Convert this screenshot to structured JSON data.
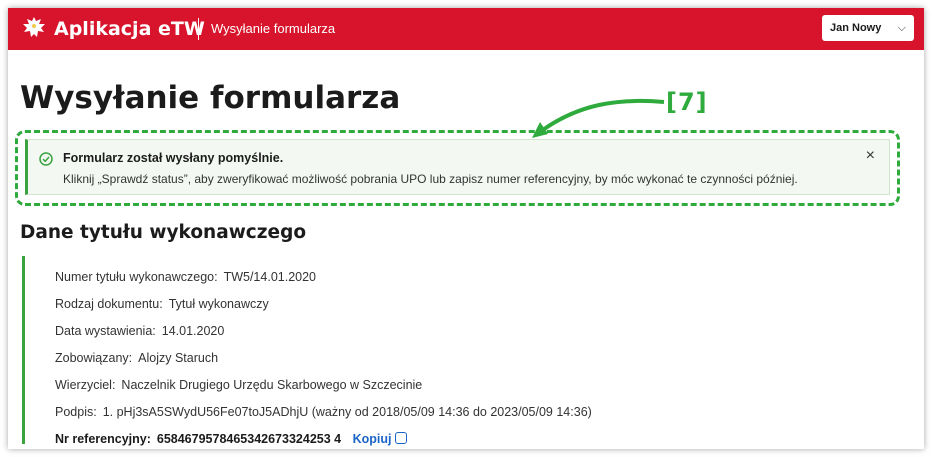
{
  "header": {
    "app_title": "Aplikacja eTW",
    "breadcrumb": "Wysyłanie formularza",
    "user_name": "Jan Nowy",
    "user_chevron": "⌵"
  },
  "page": {
    "title": "Wysyłanie formularza"
  },
  "annotation": {
    "marker_label": "[7]"
  },
  "alert": {
    "title": "Formularz został wysłany pomyślnie.",
    "message": "Kliknij „Sprawdź status”, aby zweryfikować możliwość pobrania UPO lub zapisz numer referencyjny, by móc wykonać te czynności później.",
    "close_symbol": "×"
  },
  "section": {
    "title": "Dane tytułu wykonawczego"
  },
  "details": {
    "numer_label": "Numer tytułu wykonawczego:",
    "numer_value": "TW5/14.01.2020",
    "rodzaj_label": "Rodzaj dokumentu:",
    "rodzaj_value": "Tytuł wykonawczy",
    "data_label": "Data wystawienia:",
    "data_value": "14.01.2020",
    "zobowiazany_label": "Zobowiązany:",
    "zobowiazany_value": "Alojzy Staruch",
    "wierzyciel_label": "Wierzyciel:",
    "wierzyciel_value": "Naczelnik Drugiego Urzędu Skarbowego w Szczecinie",
    "podpis_label": "Podpis:",
    "podpis_value": "1. pHj3sA5SWydU56Fe07toJ5ADhjU (ważny od 2018/05/09 14:36 do 2023/05/09 14:36)",
    "ref_label": "Nr referencyjny:",
    "ref_value": "6584679578465342673324253 4",
    "copy_label": "Kopiuj"
  },
  "colors": {
    "brand_red": "#d7142b",
    "success_green": "#3aa23f",
    "annotation_green": "#2eab3c",
    "link_blue": "#1b64c8"
  }
}
